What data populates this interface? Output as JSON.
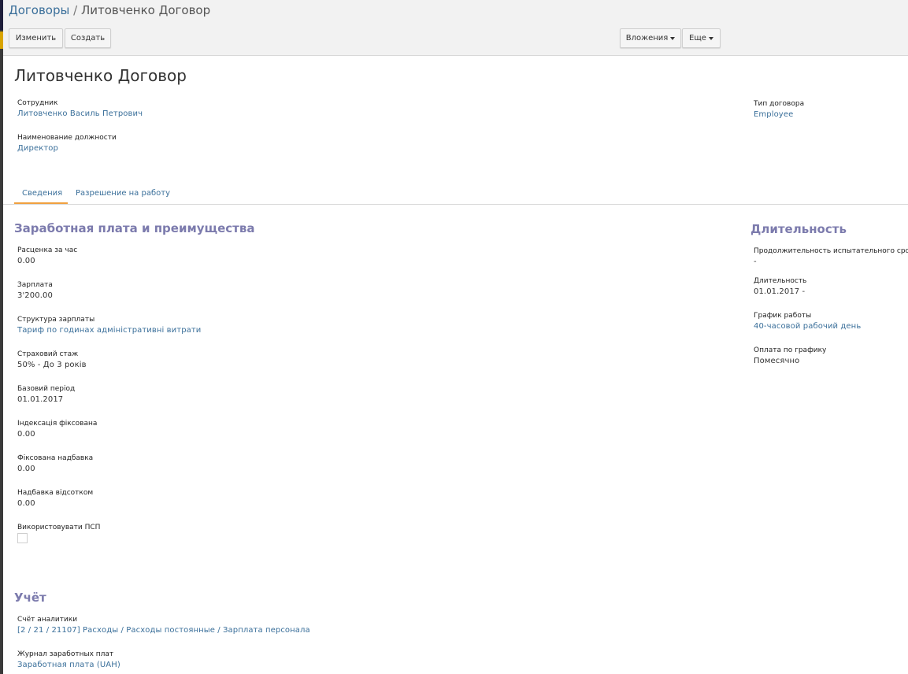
{
  "breadcrumb": {
    "parent": "Договоры",
    "separator": " / ",
    "current": "Литовченко Договор"
  },
  "toolbar": {
    "edit_label": "Изменить",
    "create_label": "Создать",
    "attachments_label": "Вложения",
    "more_label": "Еще"
  },
  "record": {
    "title": "Литовченко Договор",
    "employee_label": "Сотрудник",
    "employee_value": "Литовченко Василь Петрович",
    "job_label": "Наименование должности",
    "job_value": "Директор",
    "contract_type_label": "Тип договора",
    "contract_type_value": "Employee"
  },
  "tabs": [
    {
      "label": "Сведения",
      "active": true
    },
    {
      "label": "Разрешение на работу",
      "active": false
    }
  ],
  "salary_section": {
    "title": "Заработная плата и преимущества",
    "fields": [
      {
        "label": "Расценка за час",
        "value": "0.00"
      },
      {
        "label": "Зарплата",
        "value": "3'200.00"
      },
      {
        "label": "Структура зарплаты",
        "value": "Тариф по годинах адміністративні витрати"
      },
      {
        "label": "Страховий стаж",
        "value": "50% - До 3 років"
      },
      {
        "label": "Базовий період",
        "value": "01.01.2017"
      },
      {
        "label": "Індексація фіксована",
        "value": "0.00"
      },
      {
        "label": "Фіксована надбавка",
        "value": "0.00"
      },
      {
        "label": "Надбавка відсотком",
        "value": "0.00"
      }
    ],
    "psp_label": "Використовувати ПСП",
    "psp_checked": false
  },
  "duration_section": {
    "title": "Длительность",
    "fields": [
      {
        "label": "Продолжительность испытательного срока",
        "value": "-"
      },
      {
        "label": "Длительность",
        "value": "01.01.2017 -"
      },
      {
        "label": "График работы",
        "value": "40-часовой рабочий день"
      },
      {
        "label": "Оплата по графику",
        "value": "Помесячно"
      }
    ]
  },
  "accounting_section": {
    "title": "Учёт",
    "fields": [
      {
        "label": "Счёт аналитики",
        "value": "[2 / 21 / 21107] Расходы / Расходы постоянные / Зарплата персонала"
      },
      {
        "label": "Журнал заработных плат",
        "value": "Заработная плата (UAH)"
      }
    ]
  },
  "colors": {
    "link": "#3a6f9a",
    "section_title": "#7c7bad",
    "tab_accent": "#f0a040",
    "panel_bg": "#f2f2f2"
  },
  "icons": {
    "dropdown": "caret-down-icon"
  }
}
